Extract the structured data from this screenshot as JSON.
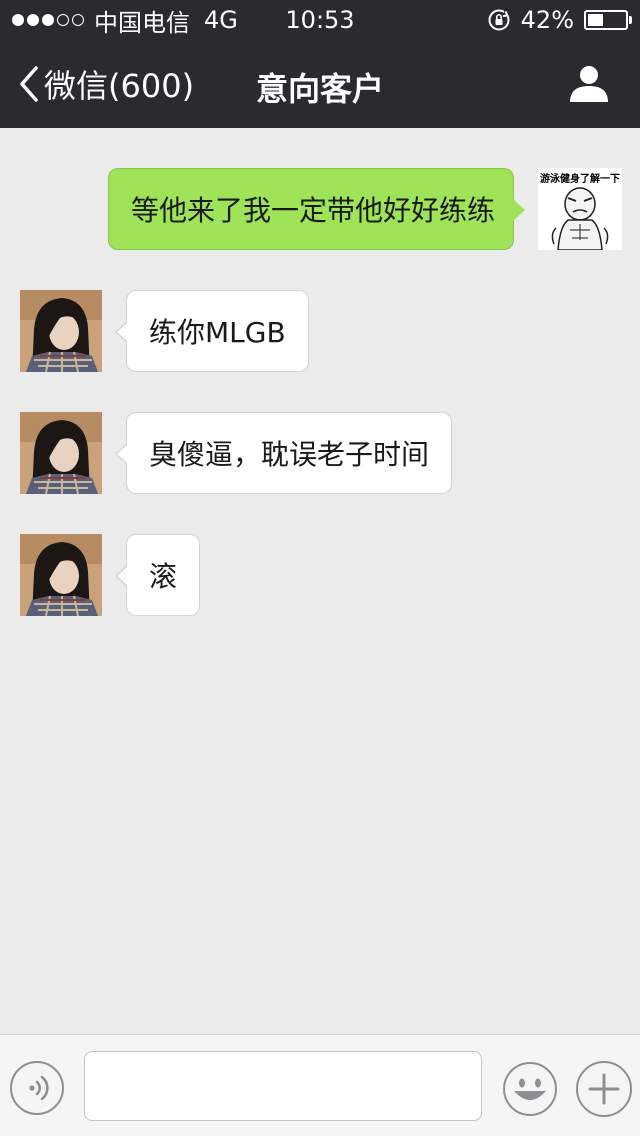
{
  "status_bar": {
    "carrier": "中国电信",
    "network": "4G",
    "time": "10:53",
    "battery": "42%",
    "battery_level": 0.42,
    "signal_filled": 3,
    "signal_total": 5
  },
  "nav": {
    "back_label": "微信(600)",
    "title": "意向客户"
  },
  "messages": [
    {
      "from": "me",
      "text": "等他来了我一定带他好好练练",
      "sticker_text": "游泳健身了解一下"
    },
    {
      "from": "other",
      "text": "练你MLGB"
    },
    {
      "from": "other",
      "text": "臭傻逼，耽误老子时间"
    },
    {
      "from": "other",
      "text": "滚"
    }
  ],
  "colors": {
    "header_bg": "#2b2a2f",
    "chat_bg": "#ebebeb",
    "outgoing_bubble": "#9fe358",
    "incoming_bubble": "#ffffff"
  },
  "icons": {
    "back": "chevron-left-icon",
    "profile": "person-icon",
    "voice": "voice-icon",
    "emoji": "smiley-icon",
    "more": "plus-icon",
    "orientation_lock": "rotation-lock-icon"
  }
}
